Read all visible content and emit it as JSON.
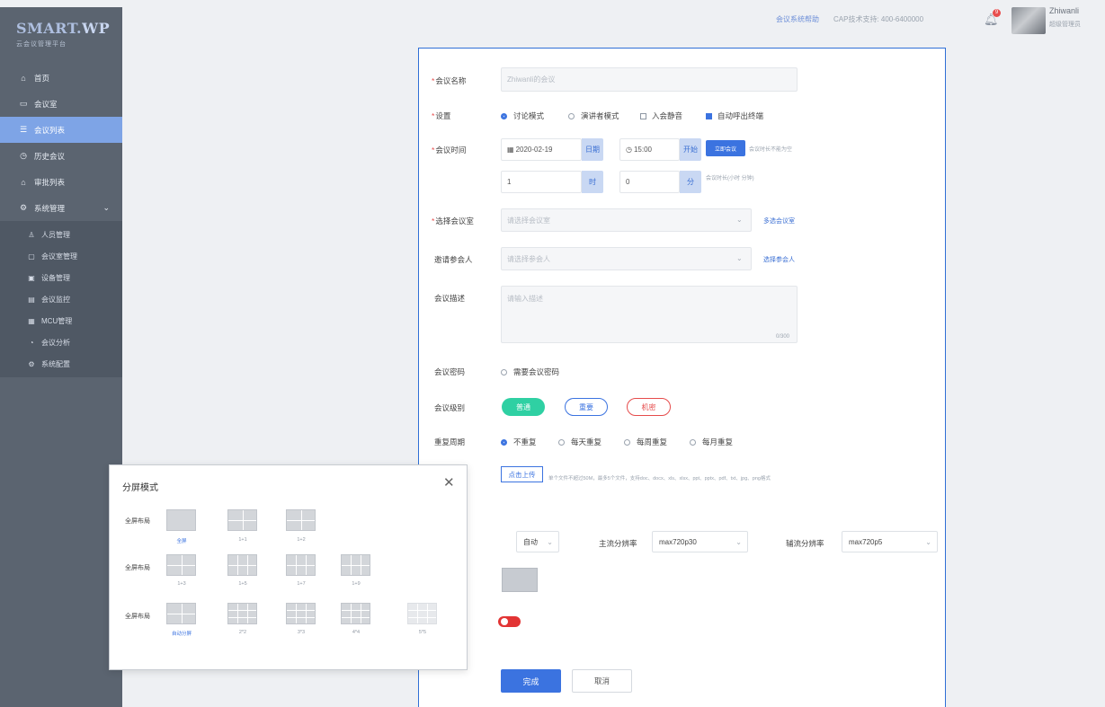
{
  "sidebar": {
    "logo": "SMART.WP",
    "logo_sub": "云会议管理平台",
    "items": [
      {
        "label": "首页",
        "icon": "home-icon"
      },
      {
        "label": "会议室",
        "icon": "room-icon"
      },
      {
        "label": "会议列表",
        "icon": "list-icon",
        "active": true
      },
      {
        "label": "历史会议",
        "icon": "history-icon"
      },
      {
        "label": "审批列表",
        "icon": "approve-icon"
      },
      {
        "label": "系统管理",
        "icon": "settings-icon"
      }
    ],
    "subitems": [
      {
        "label": "人员管理",
        "icon": "people-icon"
      },
      {
        "label": "会议室管理",
        "icon": "room-manage-icon"
      },
      {
        "label": "设备管理",
        "icon": "device-icon"
      },
      {
        "label": "会议监控",
        "icon": "monitor-icon"
      },
      {
        "label": "MCU管理",
        "icon": "mcu-icon"
      },
      {
        "label": "会议分析",
        "icon": "analysis-icon"
      },
      {
        "label": "系统配置",
        "icon": "config-icon"
      }
    ]
  },
  "topbar": {
    "link": "会议系统帮助",
    "tel": "CAP技术支持: 400-6400000",
    "badge": "9",
    "user_name": "Zhiwanli",
    "user_role": "超级管理员"
  },
  "form": {
    "name_label": "会议名称",
    "name_placeholder": "Zhiwanli的会议",
    "settings_label": "设置",
    "settings_options": [
      {
        "label": "讨论模式",
        "type": "radio",
        "checked": true
      },
      {
        "label": "演讲者模式",
        "type": "radio",
        "checked": false
      },
      {
        "label": "入会静音",
        "type": "checkbox",
        "checked": false
      },
      {
        "label": "自动呼出终端",
        "type": "checkbox",
        "checked": true
      }
    ],
    "time_label": "会议时间",
    "date_value": "2020-02-19",
    "date_addon": "日期",
    "time_value": "15:00",
    "time_addon": "开始",
    "now_button": "立即会议",
    "now_note": "会议时长不能为空",
    "hours_value": "1",
    "hours_addon": "时",
    "minutes_value": "0",
    "minutes_addon": "分",
    "duration_note": "会议时长(小时 分钟)",
    "room_label": "选择会议室",
    "room_placeholder": "请选择会议室",
    "room_link": "多选会议室",
    "participants_label": "邀请参会人",
    "participants_placeholder": "请选择参会人",
    "participants_link": "选择参会人",
    "desc_label": "会议描述",
    "desc_placeholder": "请输入描述",
    "desc_count": "0/300",
    "password_label": "会议密码",
    "password_option": "需要会议密码",
    "level_label": "会议级别",
    "levels": [
      "普通",
      "重要",
      "机密"
    ],
    "repeat_label": "重复周期",
    "repeat_options": [
      {
        "label": "不重复",
        "checked": true
      },
      {
        "label": "每天重复",
        "checked": false
      },
      {
        "label": "每周重复",
        "checked": false
      },
      {
        "label": "每月重复",
        "checked": false
      }
    ],
    "upload_button": "点击上传",
    "upload_note": "单个文件不超过50M，最多5个文件，支持doc、docx、xls、xlsx、ppt、pptx、pdf、txt、jpg、png格式",
    "mode_value": "自动",
    "main_stream_label": "主流分辨率",
    "main_stream_value": "max720p30",
    "aux_stream_label": "辅流分辨率",
    "aux_stream_value": "max720p5",
    "submit_button": "完成",
    "cancel_button": "取消"
  },
  "modal": {
    "title": "分屏模式",
    "rows": [
      {
        "label": "全屏布局",
        "items": [
          {
            "caption": "全屏",
            "selected": true,
            "style": "plain"
          },
          {
            "caption": "1+1",
            "selected": false,
            "style": "grid4"
          },
          {
            "caption": "1+2",
            "selected": false,
            "style": "grid4"
          }
        ]
      },
      {
        "label": "全屏布局",
        "items": [
          {
            "caption": "1+3",
            "selected": false,
            "style": "grid4"
          },
          {
            "caption": "1+5",
            "selected": false,
            "style": "grid6"
          },
          {
            "caption": "1+7",
            "selected": false,
            "style": "grid6"
          },
          {
            "caption": "1+9",
            "selected": false,
            "style": "grid6"
          }
        ]
      },
      {
        "label": "全屏布局",
        "items": [
          {
            "caption": "自动分屏",
            "selected": true,
            "style": "grid4"
          },
          {
            "caption": "2*2",
            "selected": false,
            "style": "grid9"
          },
          {
            "caption": "3*3",
            "selected": false,
            "style": "grid9"
          },
          {
            "caption": "4*4",
            "selected": false,
            "style": "grid9"
          },
          {
            "caption": "5*5",
            "selected": false,
            "style": "light"
          }
        ]
      }
    ]
  }
}
